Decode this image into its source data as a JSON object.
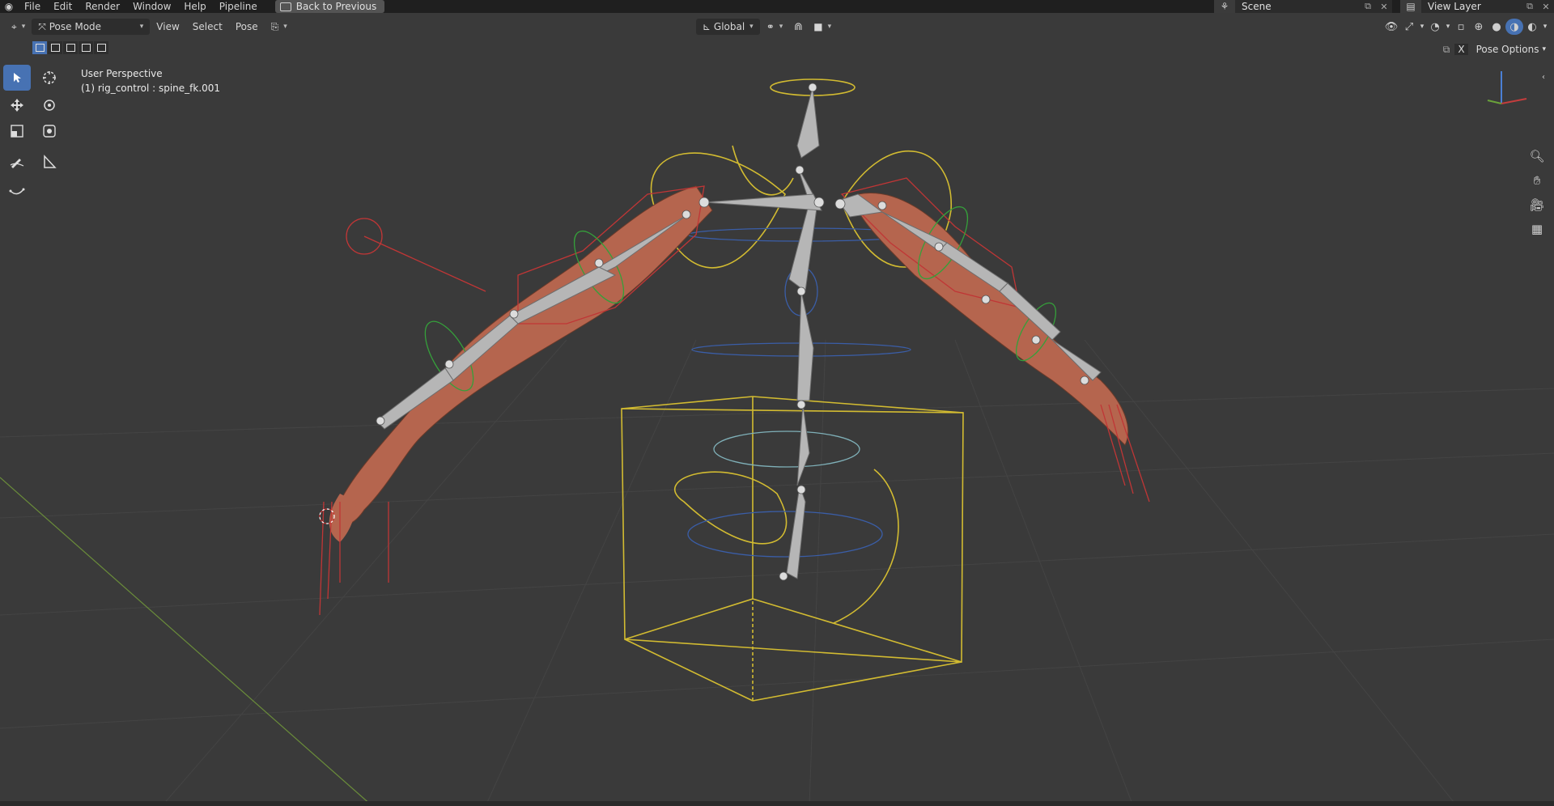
{
  "topbar": {
    "menus": [
      "File",
      "Edit",
      "Render",
      "Window",
      "Help",
      "Pipeline"
    ],
    "back_button": "Back to Previous",
    "scene": "Scene",
    "view_layer": "View Layer"
  },
  "header": {
    "mode": "Pose Mode",
    "menus": [
      "View",
      "Select",
      "Pose"
    ],
    "transform_orientation": "Global",
    "pose_options": "Pose Options",
    "pose_options_x": "X"
  },
  "viewport": {
    "perspective": "User Perspective",
    "active_object": "(1) rig_control : spine_fk.001"
  },
  "tools": [
    "select-box",
    "cursor",
    "move",
    "rotate",
    "scale",
    "transform",
    "annotate",
    "measure",
    "relax"
  ],
  "colors": {
    "viewport_bg": "#3a3a3a",
    "accent": "#4772b3",
    "bone": "#b8b8b8",
    "control_yellow": "#e0c83a",
    "control_red": "#c73a3a",
    "control_green": "#3aa83a",
    "control_blue": "#3a5ea8",
    "skin": "#b8604a"
  }
}
